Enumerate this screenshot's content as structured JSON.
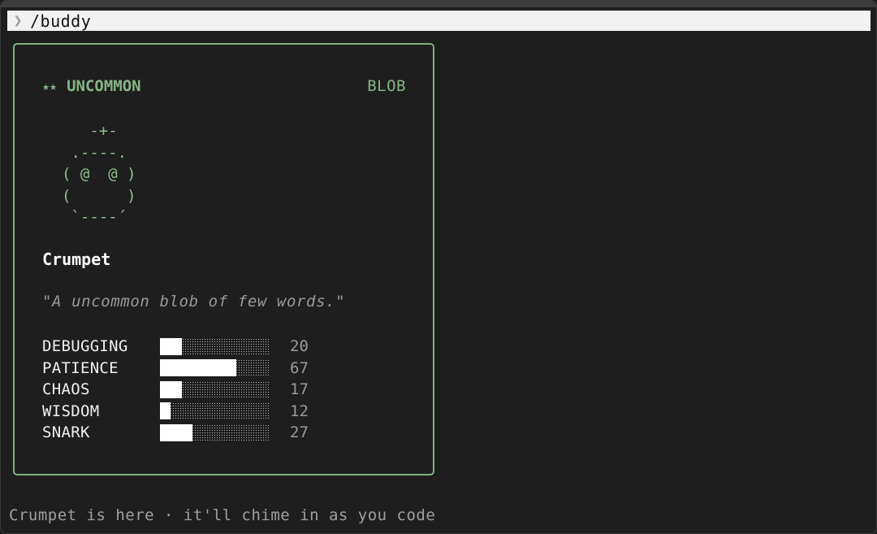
{
  "prompt": {
    "chevron": "❯",
    "command": "/buddy"
  },
  "card": {
    "stars": "★★",
    "rarity": "UNCOMMON",
    "species": "BLOB",
    "ascii_art": "   -+-\n .----.\n( @  @ )\n(      )\n `----´",
    "name": "Crumpet",
    "quote": "\"A uncommon blob of few words.\"",
    "stats": [
      {
        "label": "DEBUGGING",
        "value": "20",
        "fraction": 0.2
      },
      {
        "label": "PATIENCE",
        "value": "67",
        "fraction": 0.7
      },
      {
        "label": "CHAOS",
        "value": "17",
        "fraction": 0.2
      },
      {
        "label": "WISDOM",
        "value": "12",
        "fraction": 0.1
      },
      {
        "label": "SNARK",
        "value": "27",
        "fraction": 0.3
      }
    ]
  },
  "footer": {
    "message": "Crumpet is here · it'll chime in as you code"
  },
  "colors": {
    "accent": "#7fb27f",
    "background": "#1e1e1e"
  }
}
